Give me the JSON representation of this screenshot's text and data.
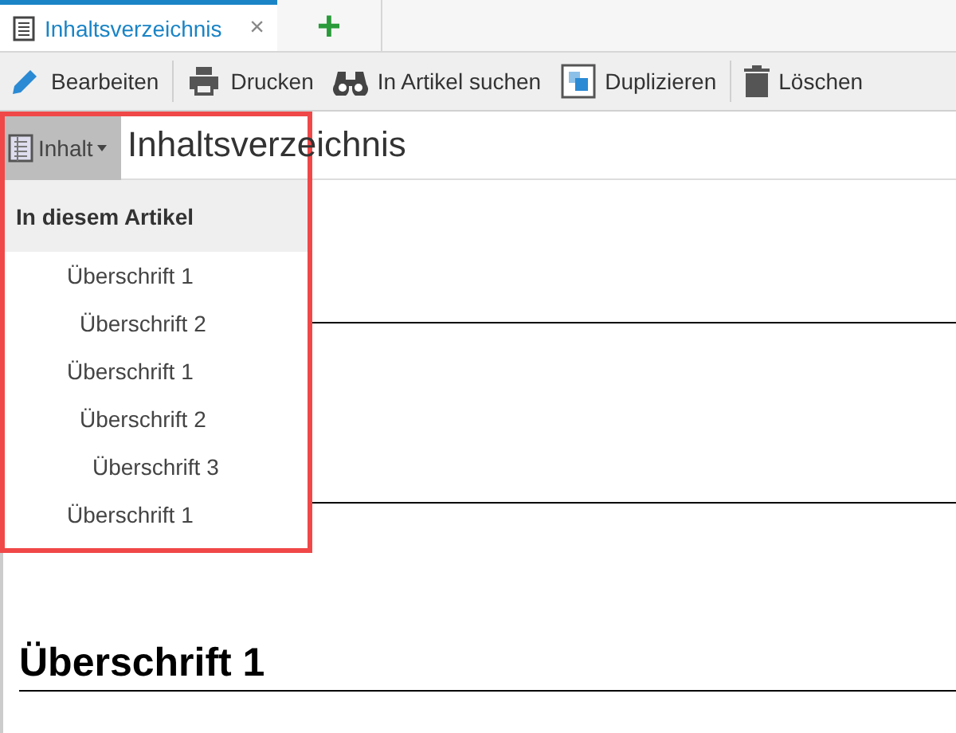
{
  "tabs": [
    {
      "label": "Inhaltsverzeichnis",
      "selected": true,
      "close": "×"
    }
  ],
  "new_tab": "+",
  "toolbar": [
    {
      "kind": "edit",
      "label": "Bearbeiten"
    },
    {
      "kind": "print",
      "label": "Drucken"
    },
    {
      "kind": "search",
      "label": "In Artikel suchen"
    },
    {
      "kind": "duplicate",
      "label": "Duplizieren"
    },
    {
      "kind": "delete",
      "label": "Löschen"
    }
  ],
  "page_title": "Inhaltsverzeichnis",
  "toc": {
    "button": "Inhalt",
    "expanded": true,
    "header": "In diesem Artikel",
    "items": [
      {
        "label": "Überschrift 1",
        "children": [
          {
            "label": "Überschrift 2"
          }
        ]
      },
      {
        "label": "Überschrift 1",
        "children": [
          {
            "label": "Überschrift 2",
            "children": [
              {
                "label": "Überschrift 3"
              }
            ]
          }
        ]
      },
      {
        "label": "Überschrift 1"
      }
    ]
  },
  "document": {
    "heading": "Überschrift 1"
  }
}
